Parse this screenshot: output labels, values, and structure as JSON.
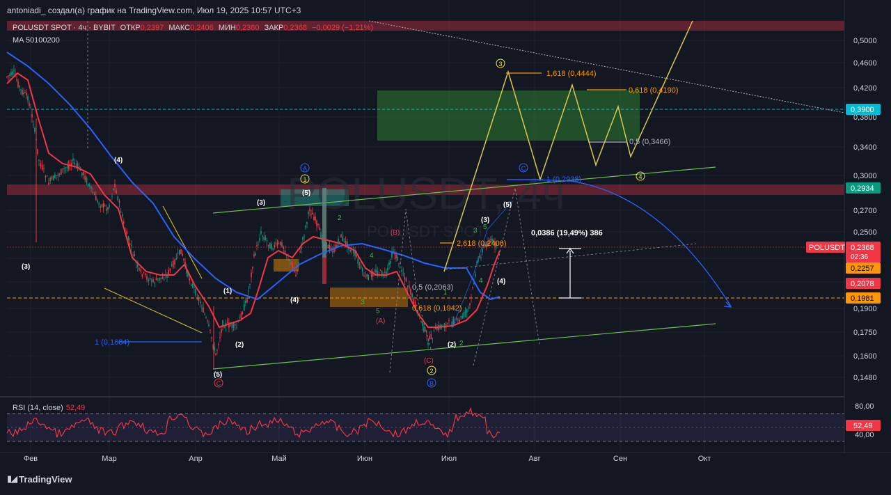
{
  "header": {
    "author_line": "antoniadi_ создал(а) график на TradingView.com, Июл 19, 2025 10:57 UTC+3"
  },
  "legend": {
    "symbol_line": "POLUSDT SPOT · 4ч · BYBIT",
    "open_label": "ОТКР",
    "open_value": "0,2397",
    "high_label": "МАКС",
    "high_value": "0,2406",
    "low_label": "МИН",
    "low_value": "0,2360",
    "close_label": "ЗАКР",
    "close_value": "0,2368",
    "change_value": "−0,0029 (−1,21%)",
    "ma_line": "MA 50100200"
  },
  "watermark": {
    "ticker": "POLUSDT, 4ч",
    "sub": "POLUSDT SPOT"
  },
  "price_axis": {
    "ticks": [
      "0,5000",
      "0,4600",
      "0,4200",
      "0,3800",
      "0,3400",
      "0,3000",
      "0,2700",
      "0,2500",
      "0,2300",
      "0,2100",
      "0,1900",
      "0,1750",
      "0,1600",
      "0,1480"
    ],
    "labels": [
      {
        "text": "0,3900",
        "value": 0.39,
        "bg": "#00bcd4",
        "fg": "#ffffff"
      },
      {
        "text": "0,2934",
        "value": 0.2934,
        "bg": "#089981",
        "fg": "#ffffff"
      },
      {
        "text": "0,2368",
        "value": 0.2368,
        "bg": "#f23645",
        "fg": "#ffffff"
      },
      {
        "text": "02:36",
        "value": 0.2368,
        "bg": "#f23645",
        "fg": "#ffffff"
      },
      {
        "text": "0,2257",
        "value": 0.2257,
        "bg": "#ff9800",
        "fg": "#000000"
      },
      {
        "text": "0,2078",
        "value": 0.2078,
        "bg": "#f23645",
        "fg": "#ffffff"
      },
      {
        "text": "0,1981",
        "value": 0.1981,
        "bg": "#ff9800",
        "fg": "#000000"
      }
    ],
    "symbol_tag": "POLUSDT"
  },
  "rsi": {
    "title": "RSI (14, close)",
    "value": "52,49",
    "ticks": [
      "80,00",
      "40,00"
    ],
    "value_tag": "52,49"
  },
  "time_axis": {
    "ticks": [
      "Фев",
      "Мар",
      "Апр",
      "Май",
      "Июн",
      "Июл",
      "Авг",
      "Сен",
      "Окт"
    ]
  },
  "annotations": {
    "fib_1618": "1,618 (0,4444)",
    "fib_0618_top": "0,618 (0,4190)",
    "fib_05_top": "0,5 (0,3466)",
    "fib_1_blue": "1 (0,2938)",
    "fib_2618": "2,618 (0,2406)",
    "fib_05_mid": "0,5 (0,2063)",
    "fib_0618_mid": "0,618 (0,1942)",
    "fib_1_low": "1 (0,1684)",
    "measure": "0,0386 (19,49%) 386",
    "waves": {
      "w3_left": "(3)",
      "w4_left": "(4)",
      "w3_b": "(3)",
      "w5_top": "(5)",
      "w1": "(1)",
      "w4_b": "(4)",
      "w2": "(2)",
      "w5_low": "(5)",
      "wC_low": "C",
      "wA_top": "A",
      "w1_circle": "1",
      "wB_red": "(B)",
      "wA_red": "(A)",
      "wC_red": "(C)",
      "w2_circle": "2",
      "wB_circle": "B",
      "w2_paren": "(2)",
      "w3_c": "(3)",
      "w4_c": "(4)",
      "w5_c": "(5)",
      "wC_blue": "C",
      "w3_circle": "3",
      "w4_circle": "4",
      "g2": "2",
      "g3": "3",
      "g4": "4",
      "g5": "5",
      "g3b": "3",
      "g4b": "4",
      "g5b": "5",
      "g2b": "2",
      "g1": "1"
    }
  },
  "footer": {
    "brand": "TradingView"
  },
  "colors": {
    "background": "#131722",
    "ma_red": "#f23645",
    "ma_blue": "#2962ff",
    "yellow": "#f0e442",
    "green_line": "#6cc04a",
    "resistance_band": "#f23645",
    "target_zone": "#2e7d32",
    "orange": "#ff9800"
  }
}
